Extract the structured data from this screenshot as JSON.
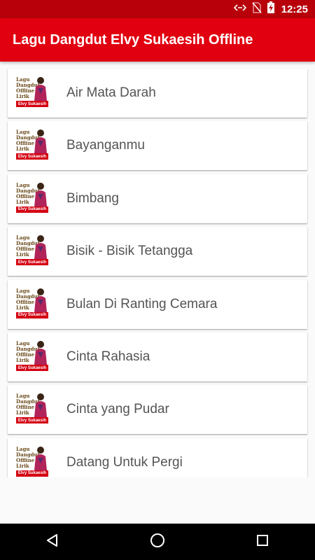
{
  "status_bar": {
    "time": "12:25",
    "icons": [
      "data-sync-icon",
      "no-sim-icon",
      "battery-charging-icon"
    ]
  },
  "app_bar": {
    "title": "Lagu Dangdut Elvy Sukaesih Offline"
  },
  "thumbnail": {
    "lines": [
      "Lagu",
      "Dangdut",
      "Offline",
      "Lirik"
    ],
    "banner": "Elvy Sukaesih"
  },
  "songs": [
    {
      "title": "Air Mata Darah"
    },
    {
      "title": "Bayanganmu"
    },
    {
      "title": "Bimbang"
    },
    {
      "title": "Bisik - Bisik Tetangga"
    },
    {
      "title": "Bulan Di Ranting Cemara"
    },
    {
      "title": "Cinta Rahasia"
    },
    {
      "title": "Cinta yang Pudar"
    },
    {
      "title": "Datang Untuk Pergi"
    }
  ],
  "nav_bar": {
    "buttons": [
      "back-icon",
      "home-icon",
      "recents-icon"
    ]
  },
  "colors": {
    "status_bar": "#b7000a",
    "app_bar": "#e00010",
    "background": "#fafafa",
    "text": "#545454"
  }
}
